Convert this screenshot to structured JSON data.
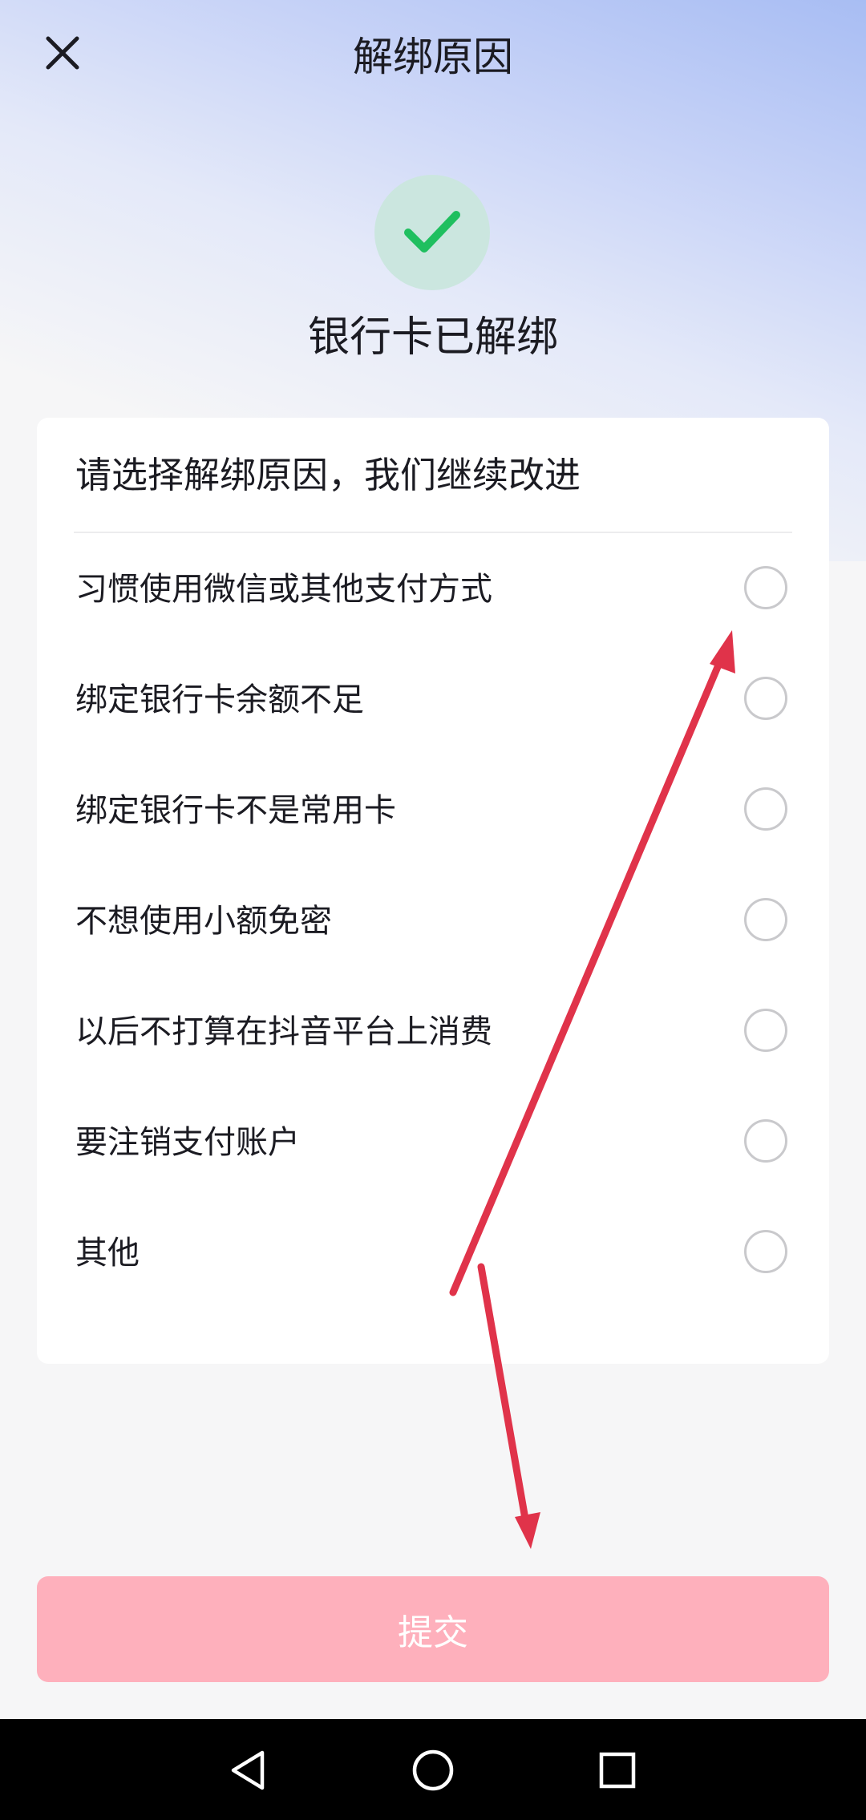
{
  "header": {
    "title": "解绑原因",
    "close_icon": "close-icon"
  },
  "status": {
    "icon": "check-icon",
    "text": "银行卡已解绑",
    "colors": {
      "circle_bg": "#cbe6df",
      "check": "#1fbf5f"
    }
  },
  "card": {
    "heading": "请选择解绑原因，我们继续改进",
    "reasons": [
      {
        "label": "习惯使用微信或其他支付方式",
        "selected": false
      },
      {
        "label": "绑定银行卡余额不足",
        "selected": false
      },
      {
        "label": "绑定银行卡不是常用卡",
        "selected": false
      },
      {
        "label": "不想使用小额免密",
        "selected": false
      },
      {
        "label": "以后不打算在抖音平台上消费",
        "selected": false
      },
      {
        "label": "要注销支付账户",
        "selected": false
      },
      {
        "label": "其他",
        "selected": false
      }
    ]
  },
  "submit": {
    "label": "提交",
    "color": "#feb0bc"
  },
  "annotation": {
    "color": "#e0334a",
    "icons": [
      "arrow-to-first-radio",
      "arrow-to-submit-button"
    ]
  },
  "navbar": {
    "icons": [
      "back-triangle-icon",
      "home-circle-icon",
      "recents-square-icon"
    ]
  }
}
